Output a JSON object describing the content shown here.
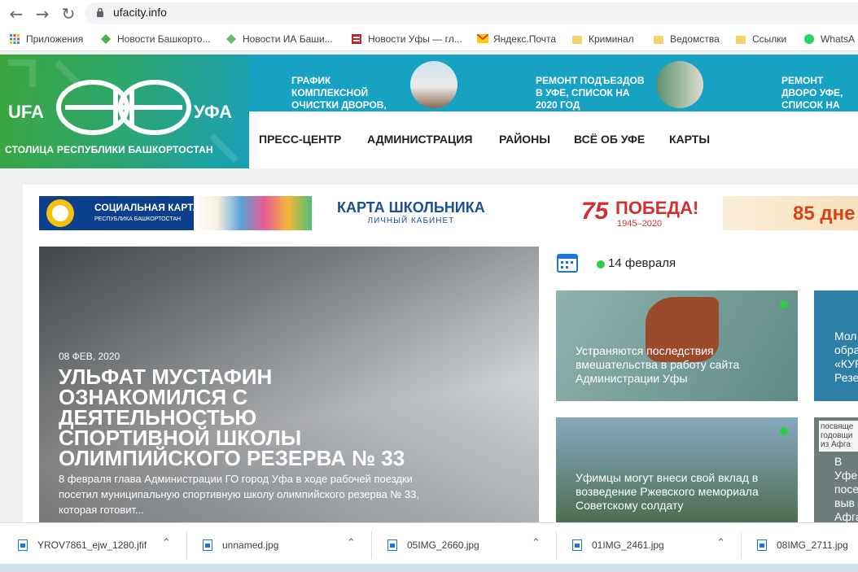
{
  "browser": {
    "url": "ufacity.info",
    "bookmarks": [
      {
        "label": "Приложения",
        "icon": "apps-grid-icon"
      },
      {
        "label": "Новости Башкорто...",
        "icon": "diamond-icon"
      },
      {
        "label": "Новости ИА Баши...",
        "icon": "diamond-icon"
      },
      {
        "label": "Новости Уфы — гл...",
        "icon": "news-icon"
      },
      {
        "label": "Яндекс.Почта",
        "icon": "mail-icon"
      },
      {
        "label": "Криминал",
        "icon": "folder-icon"
      },
      {
        "label": "Ведомства",
        "icon": "folder-icon"
      },
      {
        "label": "Ссылки",
        "icon": "folder-icon"
      },
      {
        "label": "WhatsA",
        "icon": "whatsapp-icon"
      }
    ]
  },
  "site": {
    "logo_left": "UFA",
    "logo_right": "УФА",
    "logo_sub": "СТОЛИЦА РЕСПУБЛИКИ БАШКОРТОСТАН",
    "ticker": [
      {
        "text": "ГРАФИК КОМПЛЕКСНОЙ ОЧИСТКИ ДВОРОВ,"
      },
      {
        "text": "РЕМОНТ ПОДЪЕЗДОВ В УФЕ, СПИСОК НА 2020 ГОД"
      },
      {
        "text": "РЕМОНТ ДВОРО УФЕ, СПИСОК НА 2020 ГОД"
      }
    ],
    "menu": [
      "ПРЕСС-ЦЕНТР",
      "АДМИНИСТРАЦИЯ",
      "РАЙОНЫ",
      "ВСЁ ОБ УФЕ",
      "КАРТЫ"
    ],
    "banners": {
      "social_card": "СОЦИАЛЬНАЯ КАРТА",
      "social_card_sub": "РЕСПУБЛИКА БАШКОРТОСТАН",
      "school_card": "КАРТА ШКОЛЬНИКА",
      "school_card_sub": "ЛИЧНЫЙ КАБИНЕТ",
      "victory_num": "75",
      "victory": "ПОБЕДА!",
      "victory_years": "1945–2020",
      "days": "85 дне"
    },
    "hero": {
      "date": "08 ФЕВ, 2020",
      "title": "Ульфат Мустафин ознакомился с деятельностью спортивной школы олимпийского резерва № 33",
      "text": "8 февраля глава Администрации ГО город Уфа в ходе рабочей поездки посетил муниципальную спортивную школу олимпийского резерва № 33, которая готовит..."
    },
    "date_label": "14 февраля",
    "cards": [
      {
        "text": "Устраняются последствия вмешательства в работу сайта Администрации Уфы"
      },
      {
        "text": "Мол обра «КУР Резе"
      },
      {
        "text": "Уфимцы могут внеси свой вклад в возведение Ржевского мемориала Советскому солдату"
      },
      {
        "text": "В Уфе посе выв Афга"
      }
    ],
    "card4_top": "посвяще годовщи из Афга"
  },
  "downloads": [
    {
      "name": "YROV7861_ejw_1280.jfif"
    },
    {
      "name": "unnamed.jpg"
    },
    {
      "name": "05IMG_2660.jpg"
    },
    {
      "name": "01IMG_2461.jpg"
    },
    {
      "name": "08IMG_2711.jpg"
    }
  ]
}
